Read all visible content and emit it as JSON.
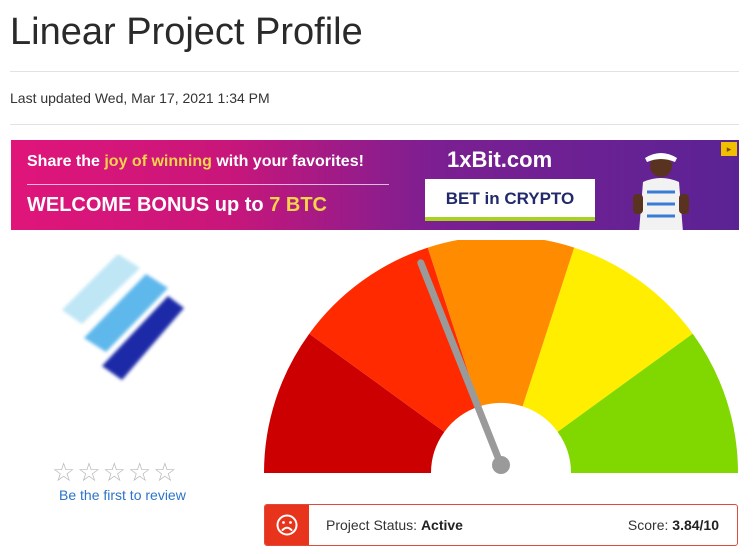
{
  "page": {
    "title": "Linear Project Profile",
    "last_updated": "Last updated Wed, Mar 17, 2021 1:34 PM"
  },
  "ad": {
    "line1_pre": "Share the ",
    "line1_highlight": "joy of winning",
    "line1_post": " with your favorites!",
    "line2_pre": "WELCOME BONUS up to ",
    "line2_highlight": "7 BTC",
    "brand": "1xBit.com",
    "cta": "BET in CRYPTO",
    "colors": {
      "start": "#e0157a",
      "end": "#5a2394",
      "highlight": "#f5d44a"
    }
  },
  "rating": {
    "stars_filled": 0,
    "stars_total": 5,
    "review_link": "Be the first to review"
  },
  "gauge": {
    "score": 3.84,
    "max": 10,
    "segment_colors": [
      "#cc0000",
      "#ff2a00",
      "#ff8c00",
      "#ffee00",
      "#80d800"
    ]
  },
  "status": {
    "icon": "sad-face-icon",
    "label": "Project Status: ",
    "value": "Active",
    "score_label": "Score: ",
    "score_value": "3.84/10",
    "accent": "#e8341c"
  }
}
